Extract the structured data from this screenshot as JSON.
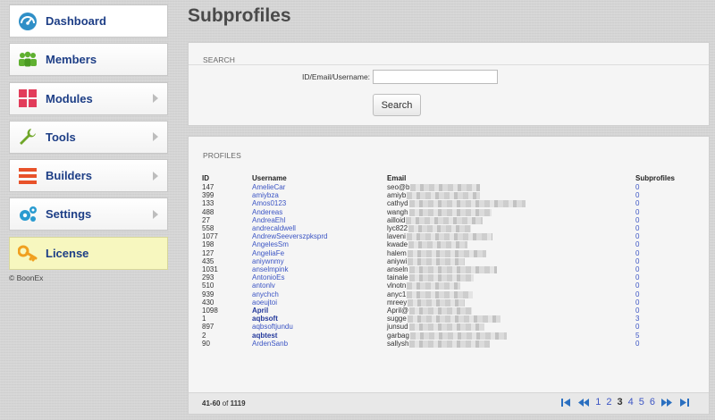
{
  "sidebar": {
    "items": [
      {
        "label": "Dashboard"
      },
      {
        "label": "Members"
      },
      {
        "label": "Modules"
      },
      {
        "label": "Tools"
      },
      {
        "label": "Builders"
      },
      {
        "label": "Settings"
      },
      {
        "label": "License"
      }
    ],
    "copyright": "© BoonEx"
  },
  "page": {
    "title": "Subprofiles"
  },
  "search": {
    "heading": "SEARCH",
    "field_label": "ID/Email/Username:",
    "field_value": "",
    "button_label": "Search"
  },
  "profiles": {
    "heading": "PROFILES",
    "columns": [
      "ID",
      "Username",
      "Email",
      "Subprofiles"
    ],
    "rows": [
      {
        "id": "147",
        "username": "AmelieCar",
        "email": "seo@b",
        "subprofiles": "0"
      },
      {
        "id": "399",
        "username": "amiybza",
        "email": "amiyb",
        "subprofiles": "0"
      },
      {
        "id": "133",
        "username": "Amos0123",
        "email": "cathyd",
        "subprofiles": "0"
      },
      {
        "id": "488",
        "username": "Andereas",
        "email": "wangh",
        "subprofiles": "0"
      },
      {
        "id": "27",
        "username": "AndreaEhl",
        "email": "ailloid",
        "subprofiles": "0"
      },
      {
        "id": "558",
        "username": "andrecaldwell",
        "email": "lyc822",
        "subprofiles": "0"
      },
      {
        "id": "1077",
        "username": "AndrewSeeverszpksprd",
        "email": "laveni",
        "subprofiles": "0"
      },
      {
        "id": "198",
        "username": "AngelesSm",
        "email": "kwade",
        "subprofiles": "0"
      },
      {
        "id": "127",
        "username": "AngeliaFe",
        "email": "halem",
        "subprofiles": "0"
      },
      {
        "id": "435",
        "username": "aniywnmy",
        "email": "aniywi",
        "subprofiles": "0"
      },
      {
        "id": "1031",
        "username": "anselmpink",
        "email": "anseln",
        "subprofiles": "0"
      },
      {
        "id": "293",
        "username": "AntonioEs",
        "email": "tainale",
        "subprofiles": "0"
      },
      {
        "id": "510",
        "username": "antonlv",
        "email": "vlnotn",
        "subprofiles": "0"
      },
      {
        "id": "939",
        "username": "anychch",
        "email": "anyc1",
        "subprofiles": "0"
      },
      {
        "id": "430",
        "username": "aoeujtoi",
        "email": "mreey",
        "subprofiles": "0"
      },
      {
        "id": "1098",
        "username": "April",
        "email": "April@",
        "subprofiles": "0"
      },
      {
        "id": "1",
        "username": "aqbsoft",
        "email": "sugge",
        "subprofiles": "3"
      },
      {
        "id": "897",
        "username": "aqbsoftjundu",
        "email": "junsud",
        "subprofiles": "0"
      },
      {
        "id": "2",
        "username": "aqbtest",
        "email": "garbag",
        "subprofiles": "5"
      },
      {
        "id": "90",
        "username": "ArdenSanb",
        "email": "sallysh",
        "subprofiles": "0"
      }
    ],
    "pager": {
      "range": "41-60",
      "of_label": "of",
      "total": "1119",
      "pages": [
        "1",
        "2",
        "3",
        "4",
        "5",
        "6"
      ],
      "current": "3"
    }
  },
  "colors": {
    "accent": "#1d6fb0",
    "link": "#3c55c4",
    "license_bg": "#f7f7bf"
  }
}
